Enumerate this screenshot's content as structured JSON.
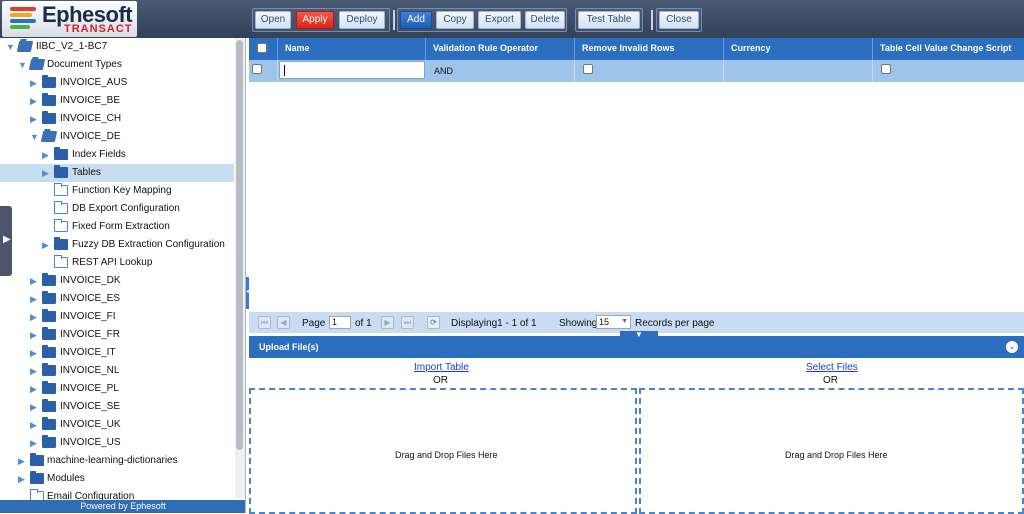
{
  "header": {
    "logo_text": "Ephesoft",
    "logo_sub": "TRANSACT",
    "buttons": {
      "open": "Open",
      "apply": "Apply",
      "deploy": "Deploy",
      "add": "Add",
      "copy": "Copy",
      "export": "Export",
      "delete": "Delete",
      "test_table": "Test Table",
      "close": "Close"
    },
    "colors": {
      "apply": "#d92418",
      "add": "#1f5fb4",
      "header_bg": "#3d4b64"
    }
  },
  "tree": {
    "root": "IIBC_V2_1-BC7",
    "document_types": "Document Types",
    "invoice_aus": "INVOICE_AUS",
    "invoice_be": "INVOICE_BE",
    "invoice_ch": "INVOICE_CH",
    "invoice_de": "INVOICE_DE",
    "index_fields": "Index Fields",
    "tables": "Tables",
    "function_key_mapping": "Function Key Mapping",
    "db_export_configuration": "DB Export Configuration",
    "fixed_form_extraction": "Fixed Form Extraction",
    "fuzzy_db_extraction_configuration": "Fuzzy DB Extraction Configuration",
    "rest_api_lookup": "REST API Lookup",
    "invoice_dk": "INVOICE_DK",
    "invoice_es": "INVOICE_ES",
    "invoice_fi": "INVOICE_FI",
    "invoice_fr": "INVOICE_FR",
    "invoice_it": "INVOICE_IT",
    "invoice_nl": "INVOICE_NL",
    "invoice_pl": "INVOICE_PL",
    "invoice_se": "INVOICE_SE",
    "invoice_uk": "INVOICE_UK",
    "invoice_us": "INVOICE_US",
    "ml_dictionaries": "machine-learning-dictionaries",
    "modules": "Modules",
    "email_configuration": "Email Configuration",
    "selected": "Tables",
    "powered_by": "Powered by Ephesoft"
  },
  "grid": {
    "columns": {
      "name": "Name",
      "validation_rule_operator": "Validation Rule Operator",
      "remove_invalid_rows": "Remove Invalid Rows",
      "currency": "Currency",
      "table_cell_value_change_script": "Table Cell Value Change Script"
    },
    "row": {
      "name": "",
      "validation_rule_operator": "AND",
      "currency": ""
    }
  },
  "pager": {
    "page_label": "Page",
    "page_value": "1",
    "of_label": "of 1",
    "displaying": "Displaying1 - 1 of 1",
    "showing_label": "Showing",
    "per_page_value": "15",
    "records_label": "Records per page"
  },
  "upload": {
    "title": "Upload File(s)",
    "import_table": "Import Table",
    "select_files": "Select Files",
    "or_left": "OR",
    "or_right": "OR",
    "drop_left": "Drag and Drop Files Here",
    "drop_right": "Drag and Drop Files Here"
  }
}
